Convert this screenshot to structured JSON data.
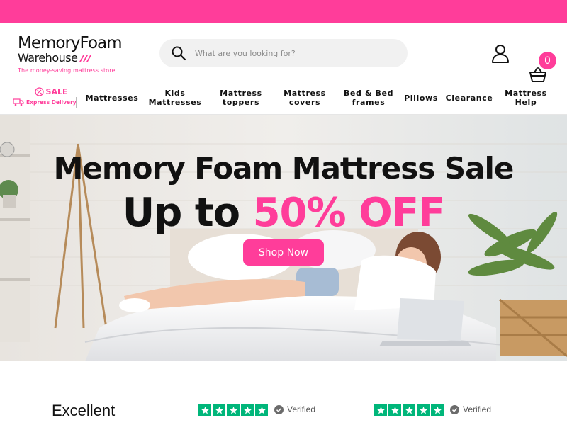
{
  "brand": {
    "name_line1": "MemoryFoam",
    "name_line2": "Warehouse",
    "tagline": "The money-saving mattress store"
  },
  "search": {
    "placeholder": "What are you looking for?"
  },
  "cart": {
    "count": "0"
  },
  "nav": {
    "sale_label": "SALE",
    "express_label": "Express Delivery",
    "items": [
      {
        "line1": "Mattresses",
        "line2": ""
      },
      {
        "line1": "Kids",
        "line2": "Mattresses"
      },
      {
        "line1": "Mattress",
        "line2": "toppers"
      },
      {
        "line1": "Mattress",
        "line2": "covers"
      },
      {
        "line1": "Bed & Bed",
        "line2": "frames"
      },
      {
        "line1": "Pillows",
        "line2": ""
      },
      {
        "line1": "Clearance",
        "line2": ""
      },
      {
        "line1": "Mattress",
        "line2": "Help"
      }
    ]
  },
  "hero": {
    "title": "Memory Foam Mattress Sale",
    "sub_prefix": "Up to ",
    "sub_highlight": "50% OFF",
    "cta": "Shop Now"
  },
  "reviews": {
    "rating_label": "Excellent",
    "verified_label_1": "Verified",
    "verified_label_2": "Verified"
  },
  "colors": {
    "brand_pink": "#ff3d9a",
    "trustpilot_green": "#00b67a"
  },
  "icons": [
    "search-icon",
    "account-icon",
    "cart-icon",
    "sale-icon",
    "truck-icon",
    "star-icon",
    "verified-icon"
  ]
}
